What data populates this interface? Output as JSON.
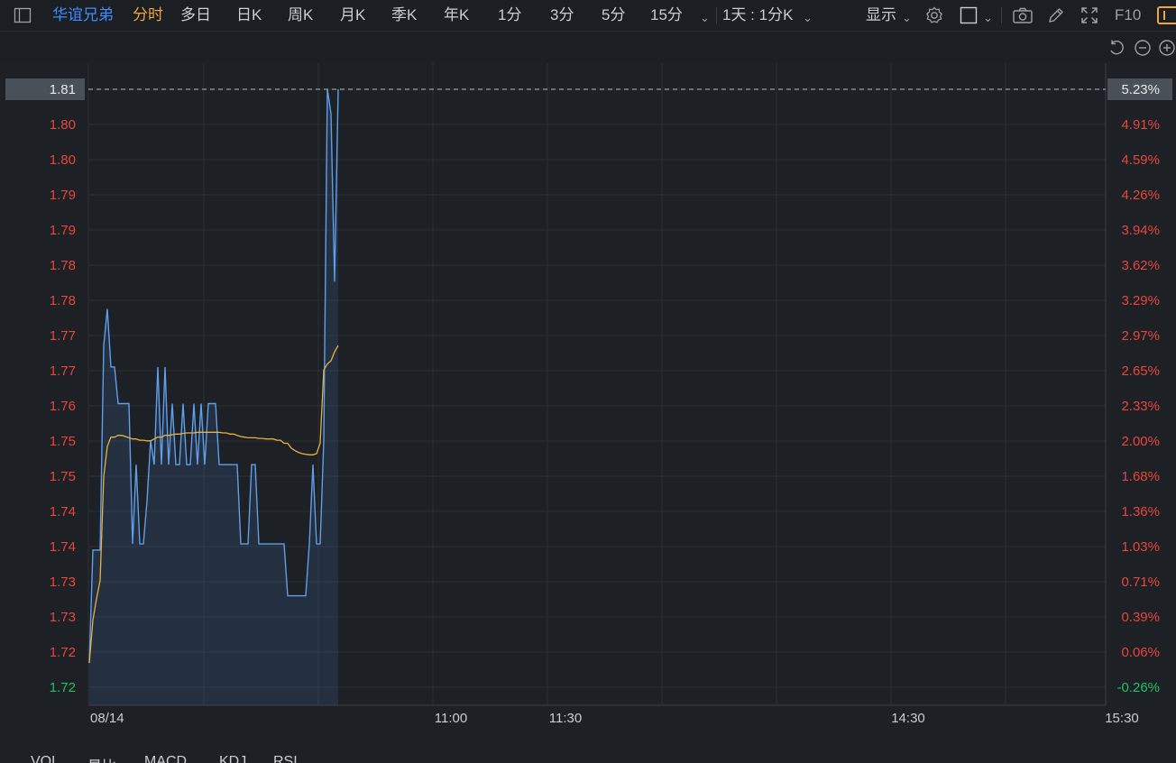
{
  "toolbar": {
    "stock_name": "华谊兄弟",
    "tabs": [
      "分时",
      "多日",
      "日K",
      "周K",
      "月K",
      "季K",
      "年K",
      "1分",
      "3分",
      "5分",
      "15分"
    ],
    "period_label": "1天 : 1分K",
    "display_label": "显示",
    "f10_label": "F10"
  },
  "bottom_tabs": [
    "VOL",
    "量比",
    "MACD",
    "KDJ",
    "RSI"
  ],
  "colors": {
    "price_line": "#5f9eea",
    "avg_line": "#e8b040",
    "up": "#e8453c",
    "down": "#22c065",
    "grid": "#2c3036"
  },
  "chart_data": {
    "type": "line",
    "left_axis_labels": [
      "1.81",
      "1.80",
      "1.80",
      "1.79",
      "1.79",
      "1.78",
      "1.78",
      "1.77",
      "1.77",
      "1.76",
      "1.75",
      "1.75",
      "1.74",
      "1.74",
      "1.73",
      "1.73",
      "1.72",
      "1.72"
    ],
    "right_axis_labels": [
      "5.23%",
      "4.91%",
      "4.59%",
      "4.26%",
      "3.94%",
      "3.62%",
      "3.29%",
      "2.97%",
      "2.65%",
      "2.33%",
      "2.00%",
      "1.68%",
      "1.36%",
      "1.03%",
      "0.71%",
      "0.39%",
      "0.06%",
      "-0.26%"
    ],
    "current_price_label": "1.81",
    "current_pct_label": "5.23%",
    "x_labels": [
      "08/14",
      "11:00",
      "11:30",
      "14:30",
      "15:30"
    ],
    "ylim": [
      1.718,
      1.8145
    ],
    "series": [
      {
        "values": [
          1.7205,
          1.739,
          1.739,
          1.739,
          1.7725,
          1.7785,
          1.769,
          1.769,
          1.763,
          1.763,
          1.763,
          1.763,
          1.74,
          1.753,
          1.74,
          1.74,
          1.747,
          1.757,
          1.753,
          1.769,
          1.753,
          1.769,
          1.753,
          1.763,
          1.753,
          1.753,
          1.763,
          1.753,
          1.753,
          1.763,
          1.753,
          1.763,
          1.753,
          1.763,
          1.763,
          1.763,
          1.753,
          1.753,
          1.753,
          1.753,
          1.753,
          1.753,
          1.74,
          1.74,
          1.74,
          1.753,
          1.753,
          1.74,
          1.74,
          1.74,
          1.74,
          1.74,
          1.74,
          1.74,
          1.74,
          1.7315,
          1.7315,
          1.7315,
          1.7315,
          1.7315,
          1.7315,
          1.74,
          1.753,
          1.74,
          1.74,
          1.757,
          1.8145,
          1.8105,
          1.783,
          1.8145
        ]
      },
      {
        "values": [
          1.7205,
          1.7275,
          1.731,
          1.734,
          1.751,
          1.756,
          1.7575,
          1.7575,
          1.7578,
          1.7578,
          1.7576,
          1.7574,
          1.7572,
          1.7572,
          1.757,
          1.757,
          1.7569,
          1.7569,
          1.7572,
          1.7575,
          1.7575,
          1.7578,
          1.7578,
          1.7579,
          1.758,
          1.758,
          1.7581,
          1.7582,
          1.7582,
          1.7582,
          1.7583,
          1.7583,
          1.7583,
          1.7583,
          1.7583,
          1.7583,
          1.7583,
          1.7582,
          1.7582,
          1.758,
          1.758,
          1.7578,
          1.7576,
          1.7575,
          1.7574,
          1.7574,
          1.7574,
          1.7573,
          1.7573,
          1.7572,
          1.7572,
          1.7572,
          1.757,
          1.757,
          1.7565,
          1.7565,
          1.7557,
          1.7553,
          1.755,
          1.7548,
          1.7547,
          1.7546,
          1.7546,
          1.7548,
          1.7565,
          1.7685,
          1.7695,
          1.77,
          1.7715,
          1.7725
        ]
      }
    ]
  }
}
